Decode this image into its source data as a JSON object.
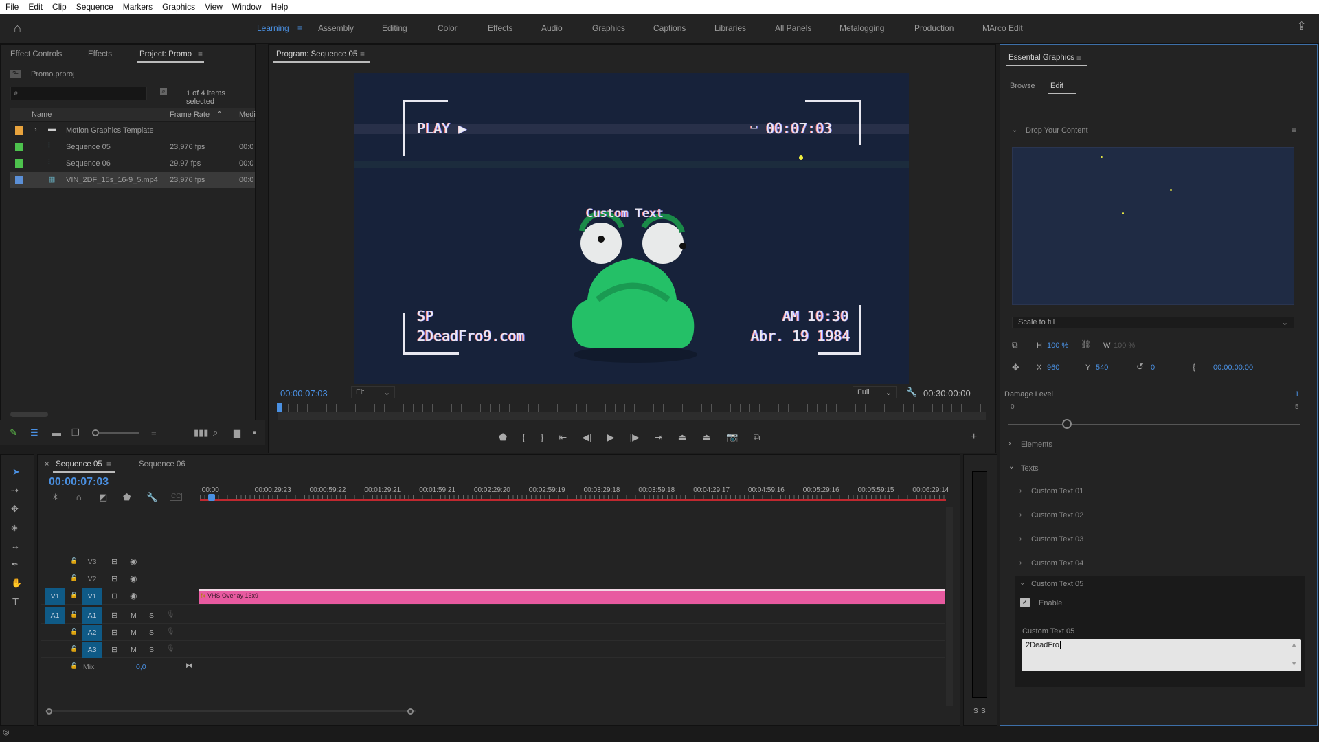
{
  "menu": [
    "File",
    "Edit",
    "Clip",
    "Sequence",
    "Markers",
    "Graphics",
    "View",
    "Window",
    "Help"
  ],
  "workspaces": [
    "Learning",
    "Assembly",
    "Editing",
    "Color",
    "Effects",
    "Audio",
    "Graphics",
    "Captions",
    "Libraries",
    "All Panels",
    "Metalogging",
    "Production",
    "MArco Edit"
  ],
  "active_workspace": "Learning",
  "project": {
    "tabs": [
      "Effect Controls",
      "Effects",
      "Project: Promo"
    ],
    "file": "Promo.prproj",
    "search_placeholder": "",
    "selection": "1 of 4 items selected",
    "columns": [
      "Name",
      "Frame Rate",
      "Medi"
    ],
    "items": [
      {
        "name": "Motion Graphics Template",
        "rate": "",
        "media": "",
        "color": "#e8a33d",
        "icon": "folder-icon"
      },
      {
        "name": "Sequence 05",
        "rate": "23,976 fps",
        "media": "00:0",
        "color": "#4dc24d",
        "icon": "sequence-icon"
      },
      {
        "name": "Sequence 06",
        "rate": "29,97 fps",
        "media": "00:0",
        "color": "#4dc24d",
        "icon": "sequence-icon"
      },
      {
        "name": "VIN_2DF_15s_16-9_5.mp4",
        "rate": "23,976 fps",
        "media": "00:0",
        "color": "#5b8fd6",
        "icon": "clip-icon",
        "selected": true
      }
    ]
  },
  "program": {
    "title": "Program: Sequence 05",
    "timecode": "00:00:07:03",
    "zoom": "Fit",
    "quality": "Full",
    "duration": "00:30:00:00",
    "overlay": {
      "play": "PLAY ▶",
      "counter": "00:07:03",
      "mode": "SP",
      "site": "2DeadFro9.com",
      "time": "AM 10:30",
      "date": "Abr. 19 1984",
      "custom": "Custom Text"
    }
  },
  "timeline": {
    "tabs": [
      "Sequence 05",
      "Sequence 06"
    ],
    "timecode": "00:00:07:03",
    "ruler": [
      ":00:00",
      "00:00:29:23",
      "00:00:59:22",
      "00:01:29:21",
      "00:01:59:21",
      "00:02:29:20",
      "00:02:59:19",
      "00:03:29:18",
      "00:03:59:18",
      "00:04:29:17",
      "00:04:59:16",
      "00:05:29:16",
      "00:05:59:15",
      "00:06:29:14"
    ],
    "video_tracks": [
      "V3",
      "V2",
      "V1"
    ],
    "audio_tracks": [
      "A1",
      "A2",
      "A3"
    ],
    "mix_label": "Mix",
    "mix_value": "0,0",
    "mute": "M",
    "solo": "S",
    "source_v": "V1",
    "source_a": "A1",
    "clip": "VHS Overlay 16x9",
    "clip_color": "#e85aa0",
    "meter_labels": [
      "S",
      "S"
    ]
  },
  "eg": {
    "title": "Essential Graphics",
    "tabs": [
      "Browse",
      "Edit"
    ],
    "section": "Drop Your Content",
    "scale": "Scale to fill",
    "h_label": "H",
    "h": "100 %",
    "w_label": "W",
    "w": "100 %",
    "x_label": "X",
    "x": "960",
    "y_label": "Y",
    "y": "540",
    "rotation": "0",
    "time": "00:00:00:00",
    "damage_label": "Damage Level",
    "damage_value": "1",
    "damage_min": "0",
    "damage_max": "5",
    "damage_fraction": 0.2,
    "elements": "Elements",
    "texts": "Texts",
    "text_items": [
      "Custom Text 01",
      "Custom Text 02",
      "Custom Text 03",
      "Custom Text 04",
      "Custom Text 05"
    ],
    "enable": "Enable",
    "field_label": "Custom Text 05",
    "field_value": "2DeadFro"
  }
}
